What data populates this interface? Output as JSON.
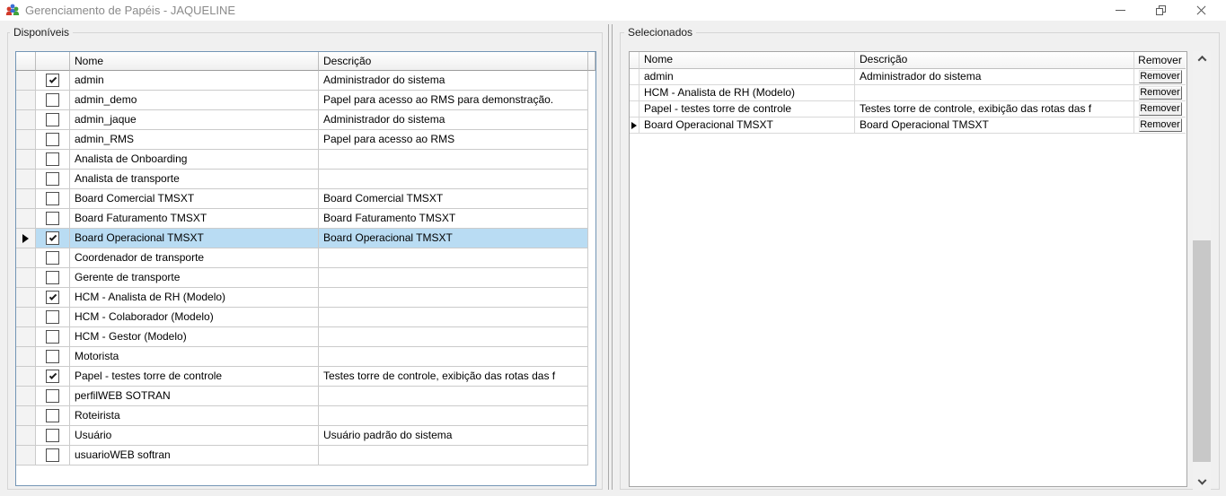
{
  "window": {
    "title": "Gerenciamento de Papéis - JAQUELINE",
    "controls": [
      "minimize",
      "restore",
      "close"
    ]
  },
  "colors": {
    "selection": "#b9dcf3",
    "available_grid_border": "#7395b5",
    "client_background": "#f0f0f0"
  },
  "icons": {
    "app": "users-icon",
    "window_controls": [
      "minimize-icon",
      "restore-icon",
      "close-icon"
    ],
    "current_row": "right-arrow-icon",
    "checked": "checkmark-icon",
    "scrollbar": [
      "chevron-up-icon",
      "chevron-down-icon"
    ]
  },
  "available_panel": {
    "label": "Disponíveis",
    "columns": {
      "name": "Nome",
      "description": "Descrição"
    },
    "rows": [
      {
        "name": "admin",
        "description": "Administrador do sistema",
        "checked": true,
        "selected": false
      },
      {
        "name": "admin_demo",
        "description": "Papel para acesso ao RMS para demonstração.",
        "checked": false,
        "selected": false
      },
      {
        "name": "admin_jaque",
        "description": "Administrador do sistema",
        "checked": false,
        "selected": false
      },
      {
        "name": "admin_RMS",
        "description": "Papel para acesso ao RMS",
        "checked": false,
        "selected": false
      },
      {
        "name": "Analista de Onboarding",
        "description": "",
        "checked": false,
        "selected": false
      },
      {
        "name": "Analista de transporte",
        "description": "",
        "checked": false,
        "selected": false
      },
      {
        "name": "Board Comercial TMSXT",
        "description": "Board Comercial TMSXT",
        "checked": false,
        "selected": false
      },
      {
        "name": "Board Faturamento TMSXT",
        "description": "Board Faturamento TMSXT",
        "checked": false,
        "selected": false
      },
      {
        "name": "Board Operacional TMSXT",
        "description": "Board Operacional TMSXT",
        "checked": true,
        "selected": true
      },
      {
        "name": "Coordenador de transporte",
        "description": "",
        "checked": false,
        "selected": false
      },
      {
        "name": "Gerente de transporte",
        "description": "",
        "checked": false,
        "selected": false
      },
      {
        "name": "HCM - Analista de RH (Modelo)",
        "description": "",
        "checked": true,
        "selected": false
      },
      {
        "name": "HCM - Colaborador (Modelo)",
        "description": "",
        "checked": false,
        "selected": false
      },
      {
        "name": "HCM - Gestor (Modelo)",
        "description": "",
        "checked": false,
        "selected": false
      },
      {
        "name": "Motorista",
        "description": "",
        "checked": false,
        "selected": false
      },
      {
        "name": "Papel - testes torre de controle",
        "description": "Testes torre de controle, exibição das rotas das f",
        "checked": true,
        "selected": false
      },
      {
        "name": "perfilWEB SOTRAN",
        "description": "",
        "checked": false,
        "selected": false
      },
      {
        "name": "Roteirista",
        "description": "",
        "checked": false,
        "selected": false
      },
      {
        "name": "Usuário",
        "description": "Usuário padrão do sistema",
        "checked": false,
        "selected": false
      },
      {
        "name": "usuarioWEB softran",
        "description": "",
        "checked": false,
        "selected": false
      }
    ]
  },
  "selected_panel": {
    "label": "Selecionados",
    "columns": {
      "name": "Nome",
      "description": "Descrição",
      "remove": "Remover"
    },
    "remove_button_label": "Remover",
    "rows": [
      {
        "name": "admin",
        "description": "Administrador do sistema",
        "current": false
      },
      {
        "name": "HCM - Analista de RH (Modelo)",
        "description": "",
        "current": false
      },
      {
        "name": "Papel - testes torre de controle",
        "description": "Testes torre de controle, exibição das rotas das f",
        "current": false
      },
      {
        "name": "Board Operacional TMSXT",
        "description": "Board Operacional TMSXT",
        "current": true
      }
    ]
  }
}
